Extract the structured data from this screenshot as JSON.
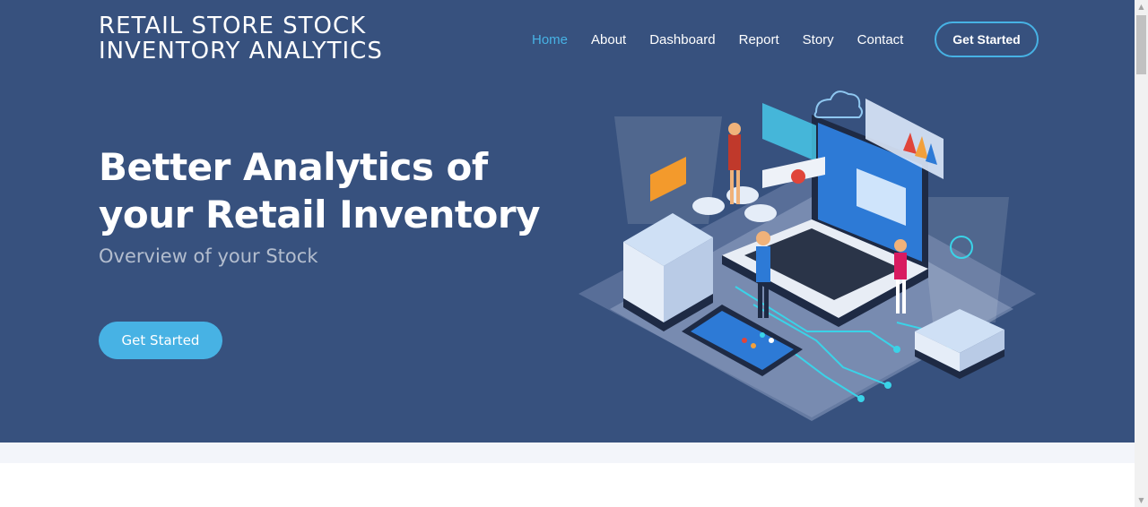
{
  "logo": {
    "text": "RETAIL STORE STOCK INVENTORY ANALYTICS"
  },
  "nav": {
    "items": [
      {
        "label": "Home",
        "active": true
      },
      {
        "label": "About"
      },
      {
        "label": "Dashboard"
      },
      {
        "label": "Report"
      },
      {
        "label": "Story"
      },
      {
        "label": "Contact"
      }
    ],
    "cta_label": "Get Started"
  },
  "hero": {
    "title": "Better Analytics of your Retail Inventory",
    "subtitle": "Overview of your Stock",
    "cta_label": "Get Started",
    "illustration": "isometric-analytics-illustration"
  },
  "colors": {
    "hero_bg": "#37517e",
    "accent": "#47b2e4",
    "section_bg": "#f3f5fa"
  }
}
